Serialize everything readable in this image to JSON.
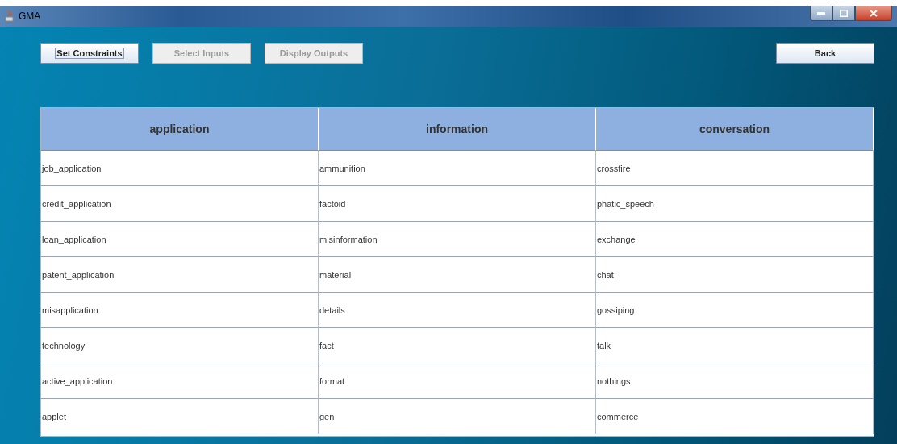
{
  "window": {
    "title": "GMA"
  },
  "buttons": [
    {
      "label": "Set Constraints",
      "disabled": false,
      "focused": true
    },
    {
      "label": "Select Inputs",
      "disabled": true,
      "focused": false
    },
    {
      "label": "Display Outputs",
      "disabled": true,
      "focused": false
    }
  ],
  "back_button": {
    "label": "Back",
    "disabled": false
  },
  "table": {
    "columns": [
      "application",
      "information",
      "conversation"
    ],
    "rows": [
      [
        "job_application",
        "ammunition",
        "crossfire"
      ],
      [
        "credit_application",
        "factoid",
        "phatic_speech"
      ],
      [
        "loan_application",
        "misinformation",
        "exchange"
      ],
      [
        "patent_application",
        "material",
        "chat"
      ],
      [
        "misapplication",
        "details",
        "gossiping"
      ],
      [
        "technology",
        "fact",
        "talk"
      ],
      [
        "active_application",
        "format",
        "nothings"
      ],
      [
        "applet",
        "gen",
        "commerce"
      ]
    ]
  }
}
